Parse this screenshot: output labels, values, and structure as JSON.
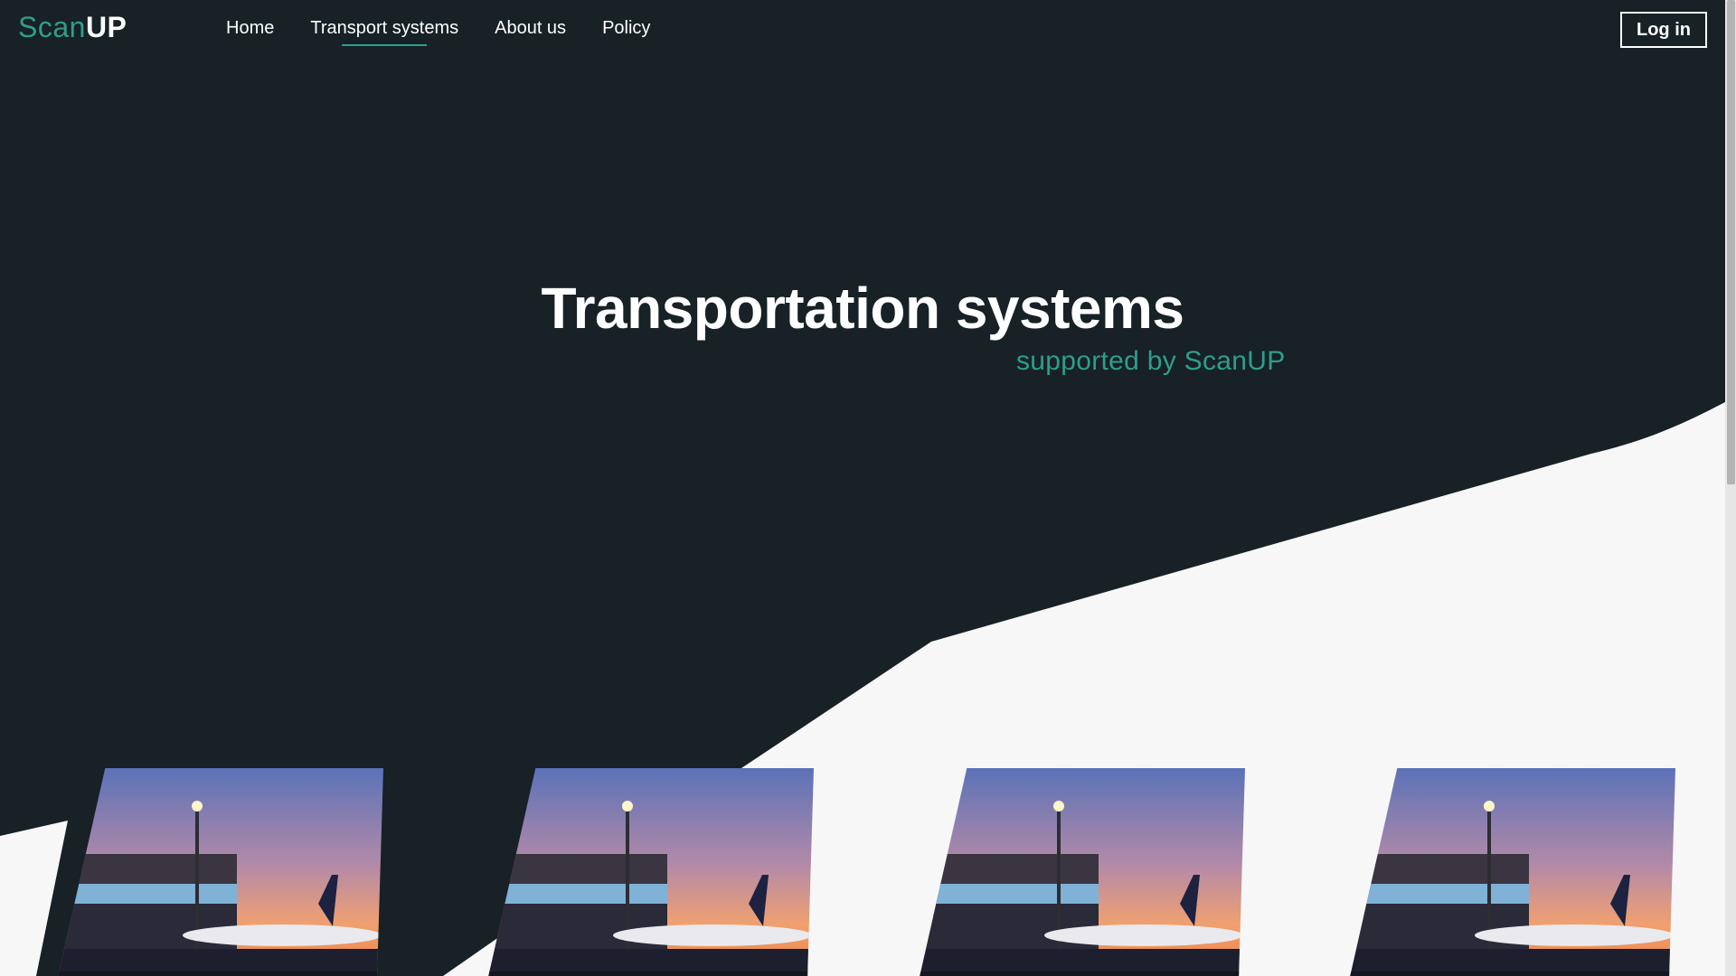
{
  "brand": {
    "part1": "Scan",
    "part2": "UP"
  },
  "nav": {
    "items": [
      {
        "label": "Home"
      },
      {
        "label": "Transport systems",
        "active": true
      },
      {
        "label": "About us"
      },
      {
        "label": "Policy"
      }
    ],
    "login_label": "Log in"
  },
  "hero": {
    "title": "Transportation systems",
    "subtitle": "supported by ScanUP"
  },
  "cards": [
    {
      "image": "airport-plane-sunset"
    },
    {
      "image": "airport-plane-sunset"
    },
    {
      "image": "airport-plane-sunset"
    },
    {
      "image": "airport-plane-sunset"
    }
  ],
  "colors": {
    "dark": "#172126",
    "accent": "#2f9e8a",
    "light": "#f7f7f7"
  }
}
